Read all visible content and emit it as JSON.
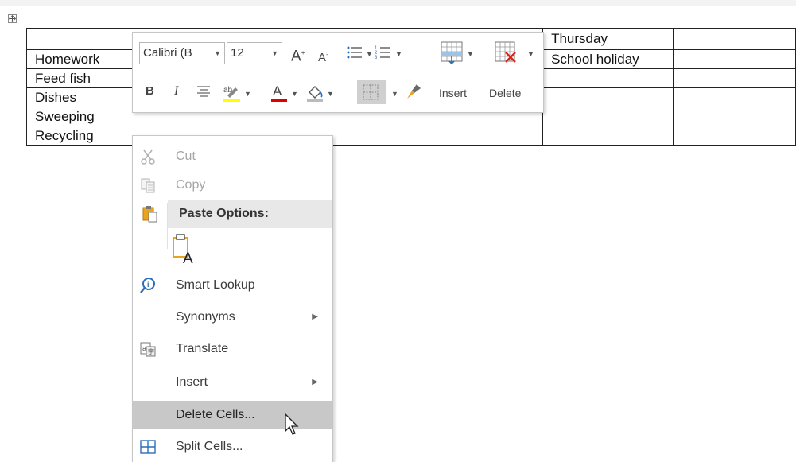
{
  "table": {
    "rows": [
      [
        "",
        "",
        "",
        "",
        "Thursday",
        ""
      ],
      [
        "Homework",
        "",
        "",
        "",
        "School holiday",
        ""
      ],
      [
        "Feed fish",
        "",
        "",
        "",
        "",
        ""
      ],
      [
        "Dishes",
        "",
        "",
        "",
        "",
        ""
      ],
      [
        "Sweeping",
        "",
        "",
        "",
        "",
        ""
      ],
      [
        "Recycling",
        "",
        "",
        "",
        "",
        ""
      ]
    ]
  },
  "toolbar": {
    "font_name": "Calibri (B",
    "font_size": "12",
    "insert_label": "Insert",
    "delete_label": "Delete",
    "highlight_color": "#ffff00",
    "font_color": "#e00000"
  },
  "menu": {
    "cut": "Cut",
    "copy": "Copy",
    "paste_options": "Paste Options:",
    "smart_lookup": "Smart Lookup",
    "synonyms": "Synonyms",
    "translate": "Translate",
    "insert": "Insert",
    "delete_cells": "Delete Cells...",
    "split_cells": "Split Cells..."
  }
}
